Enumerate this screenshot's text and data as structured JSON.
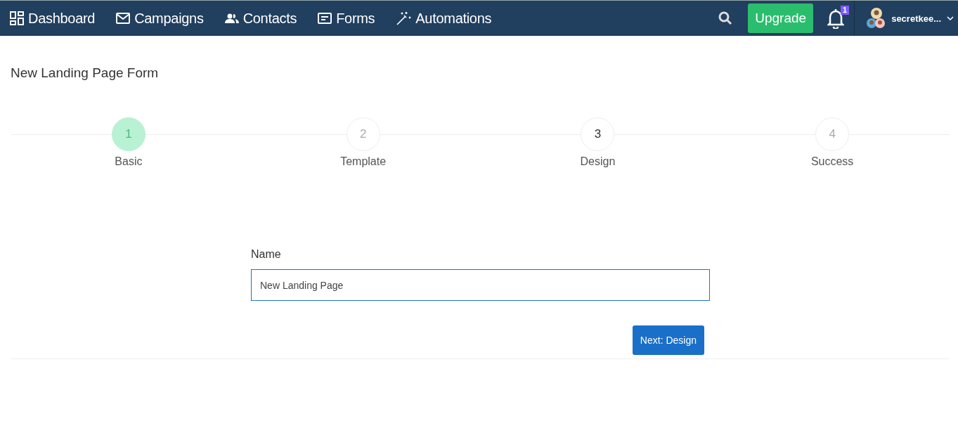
{
  "nav": {
    "items": [
      {
        "label": "Dashboard",
        "kind": "dashboard"
      },
      {
        "label": "Campaigns",
        "kind": "mail"
      },
      {
        "label": "Contacts",
        "kind": "people"
      },
      {
        "label": "Forms",
        "kind": "form"
      },
      {
        "label": "Automations",
        "kind": "wand"
      }
    ],
    "upgrade": "Upgrade",
    "notification_count": "1",
    "user": "secretkee..."
  },
  "page_title": "New Landing Page Form",
  "steps": [
    {
      "number": "1",
      "label": "Basic",
      "selected": true,
      "emphasized": false
    },
    {
      "number": "2",
      "label": "Template",
      "selected": false,
      "emphasized": false
    },
    {
      "number": "3",
      "label": "Design",
      "selected": false,
      "emphasized": true
    },
    {
      "number": "4",
      "label": "Success",
      "selected": false,
      "emphasized": false
    }
  ],
  "form": {
    "name_label": "Name",
    "name_value": "New Landing Page",
    "next_button": "Next: Design"
  }
}
